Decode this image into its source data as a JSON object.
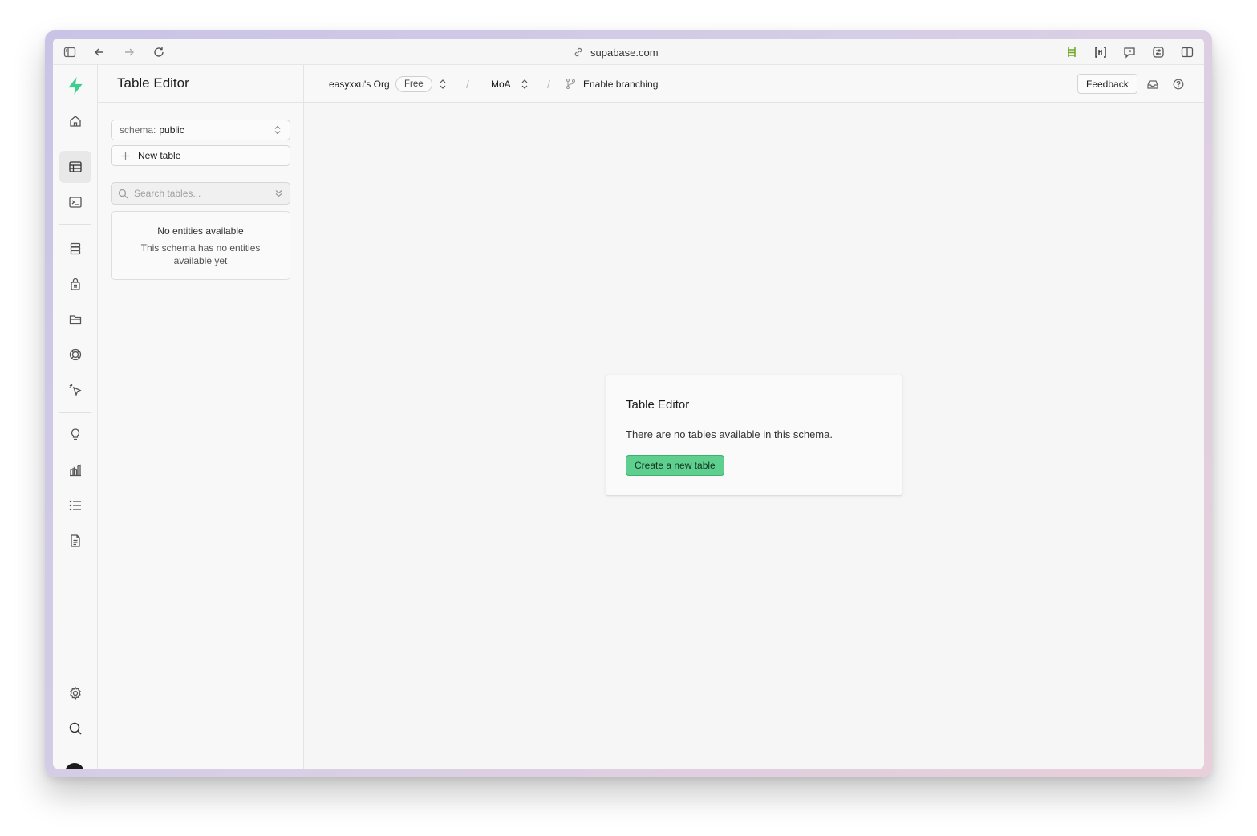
{
  "browser": {
    "url": "supabase.com"
  },
  "rail": {
    "items": [
      {
        "name": "home-icon",
        "label": "Home"
      },
      {
        "name": "table-editor-icon",
        "label": "Table Editor",
        "active": true
      },
      {
        "name": "sql-editor-icon",
        "label": "SQL Editor"
      },
      {
        "name": "database-icon",
        "label": "Database"
      },
      {
        "name": "authentication-icon",
        "label": "Authentication"
      },
      {
        "name": "storage-icon",
        "label": "Storage"
      },
      {
        "name": "realtime-icon",
        "label": "Realtime"
      },
      {
        "name": "edge-functions-icon",
        "label": "Edge Functions"
      },
      {
        "name": "advisors-icon",
        "label": "Advisors"
      },
      {
        "name": "reports-icon",
        "label": "Reports"
      },
      {
        "name": "logs-icon",
        "label": "Logs"
      },
      {
        "name": "api-docs-icon",
        "label": "API Docs"
      },
      {
        "name": "settings-icon",
        "label": "Settings"
      },
      {
        "name": "search-icon",
        "label": "Search"
      }
    ],
    "brand_color": "#3ecf8e"
  },
  "panel": {
    "title": "Table Editor",
    "schema_key": "schema:",
    "schema_value": "public",
    "new_table_label": "New table",
    "search_placeholder": "Search tables...",
    "empty_title": "No entities available",
    "empty_desc": "This schema has no entities available yet"
  },
  "topnav": {
    "org": "easyxxu's Org",
    "plan": "Free",
    "separator": "/",
    "project": "MoA",
    "branching": "Enable branching",
    "feedback": "Feedback"
  },
  "main": {
    "dialog_title": "Table Editor",
    "dialog_body": "There are no tables available in this schema.",
    "create_button": "Create a new table"
  },
  "colors": {
    "accent": "#3ecf8e",
    "button_green": "#5fcf8f"
  }
}
